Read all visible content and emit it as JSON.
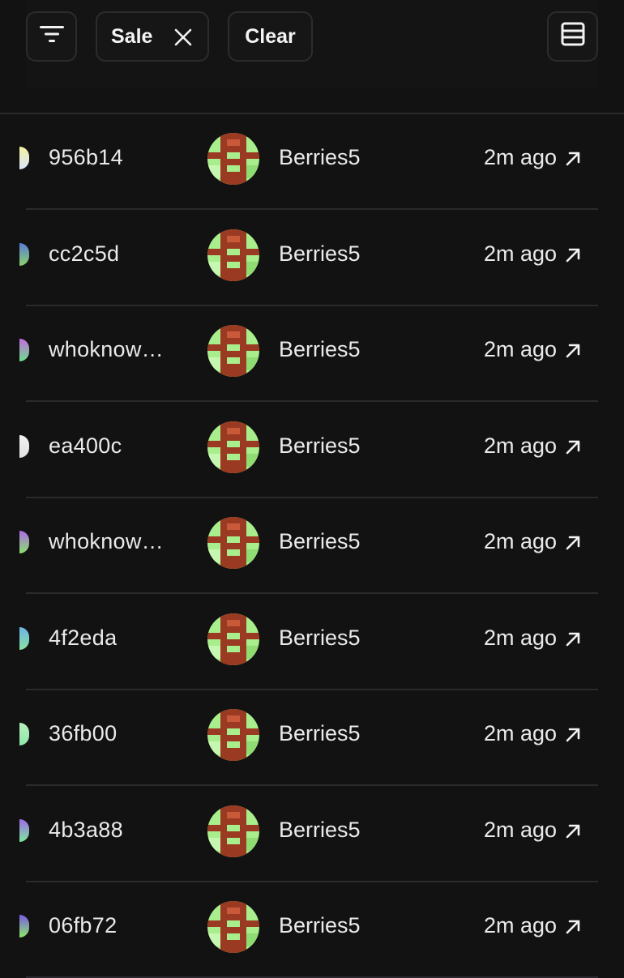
{
  "toolbar": {
    "filter_icon": "filter-lines-icon",
    "chip_label": "Sale",
    "chip_close_icon": "close-icon",
    "clear_label": "Clear",
    "layout_icon": "list-layout-icon"
  },
  "colors": {
    "background": "#121212",
    "divider": "#2a2a2e",
    "avatar_green": "#a8ee8c",
    "avatar_red": "#9a3a22"
  },
  "rows": [
    {
      "id": "956b14",
      "user": "Berries5",
      "time": "2m ago",
      "edge": [
        "#f5f0a0",
        "#d8e6ff"
      ]
    },
    {
      "id": "cc2c5d",
      "user": "Berries5",
      "time": "2m ago",
      "edge": [
        "#5b7bd8",
        "#8ad26a"
      ]
    },
    {
      "id": "whoknow…",
      "user": "Berries5",
      "time": "2m ago",
      "edge": [
        "#c86ae0",
        "#6be08a"
      ]
    },
    {
      "id": "ea400c",
      "user": "Berries5",
      "time": "2m ago",
      "edge": [
        "#f2f2f2",
        "#e0e0e0"
      ]
    },
    {
      "id": "whoknow…",
      "user": "Berries5",
      "time": "2m ago",
      "edge": [
        "#b06ae8",
        "#8ae06a"
      ]
    },
    {
      "id": "4f2eda",
      "user": "Berries5",
      "time": "2m ago",
      "edge": [
        "#6ab4e8",
        "#8ae0a0"
      ]
    },
    {
      "id": "36fb00",
      "user": "Berries5",
      "time": "2m ago",
      "edge": [
        "#b8f0c0",
        "#8ee8a8"
      ]
    },
    {
      "id": "4b3a88",
      "user": "Berries5",
      "time": "2m ago",
      "edge": [
        "#a06ae8",
        "#7ae89a"
      ]
    },
    {
      "id": "06fb72",
      "user": "Berries5",
      "time": "2m ago",
      "edge": [
        "#7a5ae8",
        "#8ae86a"
      ]
    }
  ]
}
